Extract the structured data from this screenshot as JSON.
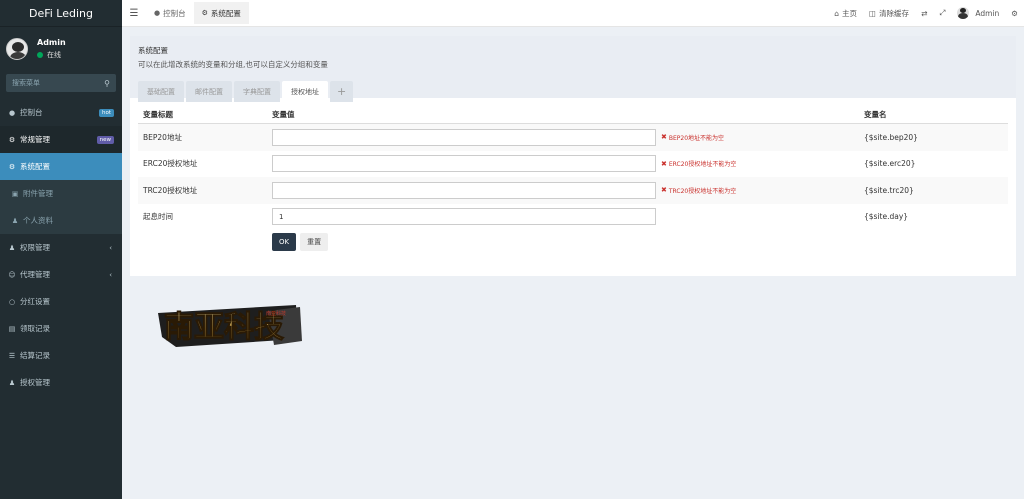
{
  "brand": "DeFi Leding",
  "user": {
    "name": "Admin",
    "status": "在线"
  },
  "search": {
    "placeholder": "搜索菜单"
  },
  "menu": [
    {
      "label": "控制台",
      "icon": "dashboard-icon",
      "badge": "hot",
      "badge_color": "#3c8dbc"
    },
    {
      "label": "常规管理",
      "icon": "gears-icon",
      "badge": "new",
      "badge_color": "#605ca8"
    },
    {
      "label": "系统配置",
      "icon": "gear-icon"
    },
    {
      "label": "附件管理",
      "icon": "file-icon"
    },
    {
      "label": "个人资料",
      "icon": "user-icon"
    },
    {
      "label": "权限管理",
      "icon": "group-icon",
      "caret": "‹"
    },
    {
      "label": "代理管理",
      "icon": "user-circle-icon",
      "caret": "‹"
    },
    {
      "label": "分红设置",
      "icon": "circle-icon"
    },
    {
      "label": "领取记录",
      "icon": "chart-icon"
    },
    {
      "label": "结算记录",
      "icon": "list-icon"
    },
    {
      "label": "授权管理",
      "icon": "users-icon"
    }
  ],
  "topbar": {
    "tabs": [
      {
        "label": "控制台"
      },
      {
        "label": "系统配置"
      }
    ],
    "home": "主页",
    "clear_cache": "清除缓存",
    "admin": "Admin"
  },
  "panel": {
    "title": "系统配置",
    "desc": "可以在此增改系统的变量和分组,也可以自定义分组和变量",
    "tabs": [
      "基础配置",
      "邮件配置",
      "字典配置",
      "授权地址"
    ],
    "plus": "+"
  },
  "table": {
    "headers": [
      "变量标题",
      "变量值",
      "变量名"
    ],
    "rows": [
      {
        "title": "BEP20地址",
        "value": "",
        "error": "BEP20地址不能为空",
        "var": "{$site.bep20}"
      },
      {
        "title": "ERC20授权地址",
        "value": "",
        "error": "ERC20授权地址不能为空",
        "var": "{$site.erc20}"
      },
      {
        "title": "TRC20授权地址",
        "value": "",
        "error": "TRC20授权地址不能为空",
        "var": "{$site.trc20}"
      },
      {
        "title": "起息时间",
        "value": "1",
        "error": "",
        "var": "{$site.day}"
      }
    ],
    "ok": "OK",
    "reset": "重置"
  },
  "logo": {
    "text": "南亚科技",
    "small": "南亚科技"
  },
  "colors": {
    "sidebar": "#222d32",
    "active": "#3c8dbc",
    "ok_button": "#2b3a4a",
    "error": "#c9302c"
  }
}
